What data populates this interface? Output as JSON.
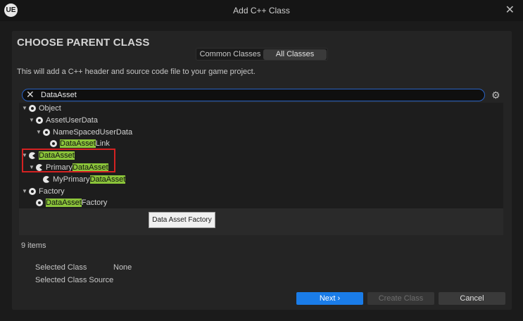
{
  "window": {
    "title": "Add C++ Class",
    "logo": "UE"
  },
  "heading": "CHOOSE PARENT CLASS",
  "toggle": {
    "common": "Common Classes",
    "all": "All Classes",
    "selected": "All Classes"
  },
  "description": "This will add a C++ header and source code file to your game project.",
  "search": {
    "value": "DataAsset"
  },
  "tree": [
    {
      "indent": 0,
      "expanded": true,
      "icon": "object-icon",
      "pre": "Object",
      "match": "",
      "post": ""
    },
    {
      "indent": 1,
      "expanded": true,
      "icon": "object-icon",
      "pre": "AssetUserData",
      "match": "",
      "post": ""
    },
    {
      "indent": 2,
      "expanded": true,
      "icon": "object-icon",
      "pre": "NameSpacedUserData",
      "match": "",
      "post": ""
    },
    {
      "indent": 3,
      "expanded": false,
      "icon": "object-icon",
      "pre": "",
      "match": "DataAsset",
      "post": "Link"
    },
    {
      "indent": 0,
      "expanded": true,
      "icon": "data-asset-icon",
      "pre": "",
      "match": "DataAsset",
      "post": ""
    },
    {
      "indent": 1,
      "expanded": true,
      "icon": "data-asset-icon",
      "pre": "Primary",
      "match": "DataAsset",
      "post": ""
    },
    {
      "indent": 2,
      "expanded": false,
      "icon": "data-asset-icon",
      "pre": "MyPrimary",
      "match": "DataAsset",
      "post": ""
    },
    {
      "indent": 0,
      "expanded": true,
      "icon": "object-icon",
      "pre": "Factory",
      "match": "",
      "post": ""
    },
    {
      "indent": 1,
      "expanded": false,
      "icon": "object-icon",
      "pre": "",
      "match": "DataAsset",
      "post": "Factory"
    }
  ],
  "tooltip": "Data Asset Factory",
  "item_count": "9 items",
  "selected": {
    "class_label": "Selected Class",
    "class_value": "None",
    "source_label": "Selected Class Source"
  },
  "buttons": {
    "next": "Next",
    "create": "Create Class",
    "cancel": "Cancel"
  },
  "colors": {
    "accent": "#1a7ce8",
    "match_highlight": "#8bc43a",
    "annotation_box": "#d42222",
    "search_focus": "#2962c4"
  }
}
